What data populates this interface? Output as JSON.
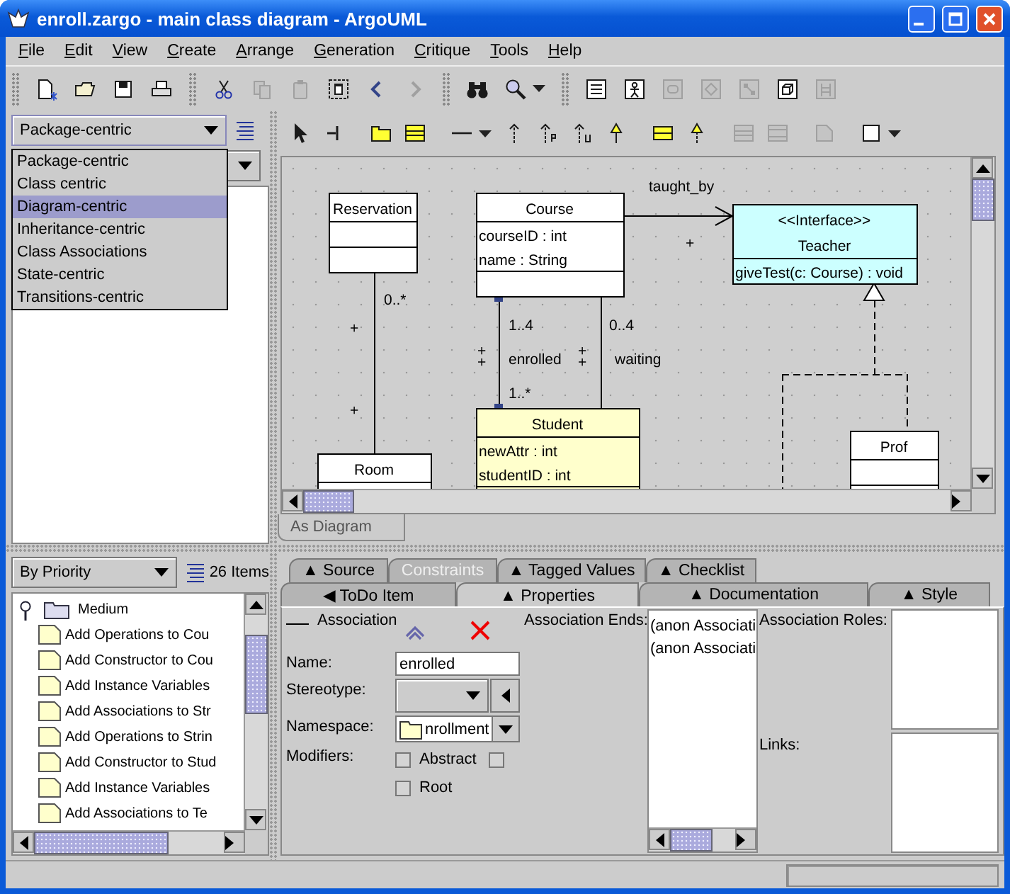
{
  "window": {
    "title": "enroll.zargo - main class diagram - ArgoUML"
  },
  "menu": [
    "File",
    "Edit",
    "View",
    "Create",
    "Arrange",
    "Generation",
    "Critique",
    "Tools",
    "Help"
  ],
  "toolbar": [
    {
      "kind": "grip"
    },
    {
      "kind": "new",
      "disabled": false
    },
    {
      "kind": "open",
      "disabled": false
    },
    {
      "kind": "save",
      "disabled": false
    },
    {
      "kind": "print",
      "disabled": false
    },
    {
      "kind": "grip"
    },
    {
      "kind": "cut",
      "disabled": false
    },
    {
      "kind": "copy",
      "disabled": true
    },
    {
      "kind": "paste",
      "disabled": true
    },
    {
      "kind": "delete",
      "disabled": false
    },
    {
      "kind": "back",
      "disabled": false
    },
    {
      "kind": "forward",
      "disabled": true
    },
    {
      "kind": "grip"
    },
    {
      "kind": "find",
      "disabled": false
    },
    {
      "kind": "zoom",
      "disabled": false,
      "dropdown": true
    },
    {
      "kind": "grip"
    },
    {
      "kind": "classdiagram",
      "disabled": false
    },
    {
      "kind": "usecase",
      "disabled": false
    },
    {
      "kind": "statediagram",
      "disabled": true
    },
    {
      "kind": "activity",
      "disabled": true
    },
    {
      "kind": "collaboration",
      "disabled": true
    },
    {
      "kind": "deployment",
      "disabled": false
    },
    {
      "kind": "sequence",
      "disabled": true
    }
  ],
  "explorer": {
    "perspective": "Package-centric",
    "perspectives": [
      {
        "label": "Package-centric",
        "selected": false
      },
      {
        "label": "Class centric",
        "selected": false
      },
      {
        "label": "Diagram-centric",
        "selected": true
      },
      {
        "label": "Inheritance-centric",
        "selected": false
      },
      {
        "label": "Class Associations",
        "selected": false
      },
      {
        "label": "State-centric",
        "selected": false
      },
      {
        "label": "Transitions-centric",
        "selected": false
      }
    ]
  },
  "diagram_toolbar": [
    {
      "kind": "select",
      "disabled": false
    },
    {
      "kind": "broadcast",
      "disabled": false
    },
    {
      "kind": "gap"
    },
    {
      "kind": "package",
      "disabled": false
    },
    {
      "kind": "class",
      "disabled": false
    },
    {
      "kind": "gap"
    },
    {
      "kind": "association",
      "disabled": false,
      "dropdown": true
    },
    {
      "kind": "dependency",
      "disabled": false
    },
    {
      "kind": "permission",
      "disabled": false
    },
    {
      "kind": "usage",
      "disabled": false
    },
    {
      "kind": "generalization",
      "disabled": false
    },
    {
      "kind": "gap"
    },
    {
      "kind": "interface",
      "disabled": false
    },
    {
      "kind": "realization",
      "disabled": false
    },
    {
      "kind": "gap"
    },
    {
      "kind": "attribute",
      "disabled": true
    },
    {
      "kind": "operation",
      "disabled": true
    },
    {
      "kind": "gap"
    },
    {
      "kind": "note",
      "disabled": true
    },
    {
      "kind": "gap"
    },
    {
      "kind": "rectangle",
      "disabled": false,
      "dropdown": true
    }
  ],
  "diagram": {
    "classes": [
      {
        "kind": "class",
        "name": "Reservation",
        "color": "#ffffff"
      },
      {
        "kind": "class",
        "name": "Course",
        "attributes": [
          "courseID : int",
          "name : String"
        ],
        "color": "#ffffff"
      },
      {
        "kind": "interface",
        "stereotype": "<<Interface>>",
        "name": "Teacher",
        "operations": [
          "giveTest(c: Course) : void"
        ],
        "color": "#ccffff"
      },
      {
        "kind": "class",
        "name": "Room",
        "color": "#ffffff"
      },
      {
        "kind": "class",
        "name": "Student",
        "attributes": [
          "newAttr : int",
          "studentID : int"
        ],
        "color": "#ffffcc"
      },
      {
        "kind": "class",
        "name": "Prof",
        "color": "#ffffff"
      }
    ],
    "edges": [
      {
        "kind": "association",
        "selected": false,
        "labels": [
          "0..*",
          "+",
          "+"
        ]
      },
      {
        "kind": "navigable",
        "selected": false,
        "labels": [
          "taught_by",
          "+"
        ]
      },
      {
        "kind": "association",
        "selected": true,
        "labels": [
          "1..4",
          "+",
          "+",
          "enrolled",
          "1..*"
        ]
      },
      {
        "kind": "association",
        "selected": false,
        "labels": [
          "0..4",
          "+",
          "+",
          "waiting"
        ]
      },
      {
        "kind": "realization",
        "selected": false
      }
    ],
    "tab": "As Diagram"
  },
  "todo": {
    "sort": "By Priority",
    "count": "26 Items",
    "tree": [
      {
        "label": "Medium",
        "expanded": true,
        "children": [
          {
            "label": "Add Operations to Cou"
          },
          {
            "label": "Add Constructor to Cou"
          },
          {
            "label": "Add Instance Variables"
          },
          {
            "label": "Add Associations to Str"
          },
          {
            "label": "Add Operations to Strin"
          },
          {
            "label": "Add Constructor to Stud"
          },
          {
            "label": "Add Instance Variables"
          },
          {
            "label": "Add Associations to Te"
          }
        ]
      }
    ]
  },
  "details": {
    "tabs_back": [
      {
        "label": "▲ Source",
        "selected": false,
        "disabled": false
      },
      {
        "label": "Constraints",
        "selected": false,
        "disabled": true
      },
      {
        "label": "▲ Tagged Values",
        "selected": false,
        "disabled": false
      },
      {
        "label": "▲ Checklist",
        "selected": false,
        "disabled": false
      }
    ],
    "tabs_front": [
      {
        "label": "◀ ToDo Item",
        "selected": false,
        "disabled": false
      },
      {
        "label": "▲ Properties",
        "selected": true,
        "disabled": false
      },
      {
        "label": "▲ Documentation",
        "selected": false,
        "disabled": false
      },
      {
        "label": "▲ Style",
        "selected": false,
        "disabled": false
      }
    ],
    "properties": {
      "type": "Association",
      "name_label": "Name:",
      "name": "enrolled",
      "stereotype_label": "Stereotype:",
      "namespace_label": "Namespace:",
      "namespace": "nrollment",
      "modifiers_label": "Modifiers:",
      "modifiers": [
        {
          "label": "Abstract",
          "checked": false
        },
        {
          "checked": false
        },
        {
          "label": "Root",
          "checked": false
        }
      ],
      "ends_label": "Association Ends:",
      "ends": [
        "(anon Associati",
        "(anon Associati"
      ],
      "roles_label": "Association Roles:",
      "links_label": "Links:"
    }
  }
}
